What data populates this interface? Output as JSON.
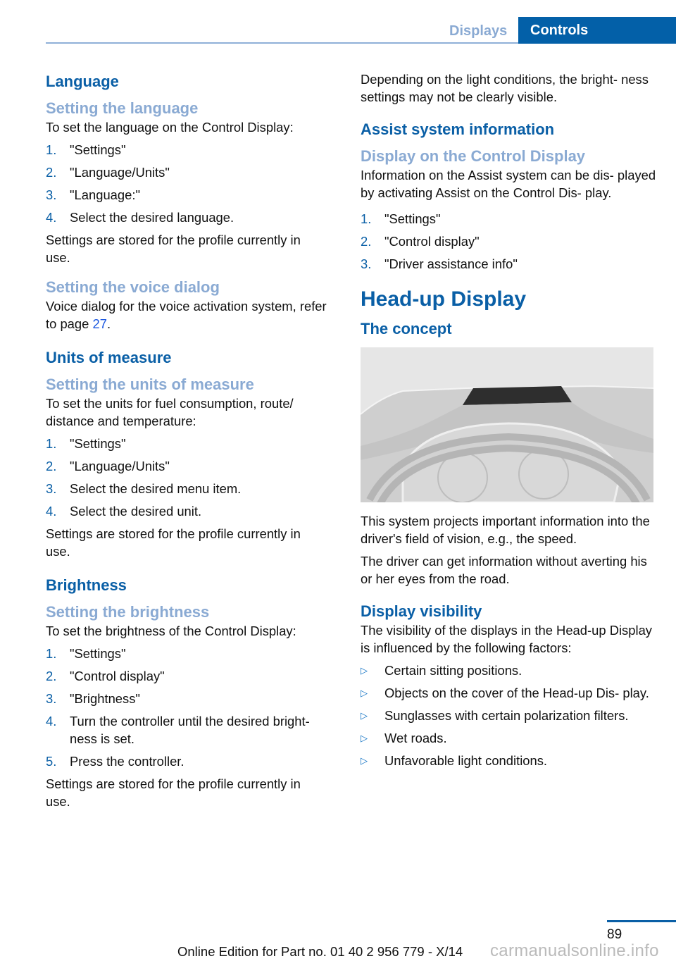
{
  "header": {
    "tabs": [
      {
        "label": "Displays",
        "active": false
      },
      {
        "label": "Controls",
        "active": true
      }
    ]
  },
  "left": {
    "language": {
      "title": "Language",
      "setting_title": "Setting the language",
      "intro": "To set the language on the Control Display:",
      "steps": [
        {
          "n": "1.",
          "text": "\"Settings\""
        },
        {
          "n": "2.",
          "text": "\"Language/Units\""
        },
        {
          "n": "3.",
          "text": "\"Language:\""
        },
        {
          "n": "4.",
          "text": "Select the desired language."
        }
      ],
      "note": "Settings are stored for the profile currently in use."
    },
    "voice": {
      "title": "Setting the voice dialog",
      "text_before": "Voice dialog for the voice activation system, refer to page ",
      "page_link": "27",
      "text_after": "."
    },
    "units": {
      "title": "Units of measure",
      "setting_title": "Setting the units of measure",
      "intro": "To set the units for fuel consumption, route/ distance and temperature:",
      "steps": [
        {
          "n": "1.",
          "text": "\"Settings\""
        },
        {
          "n": "2.",
          "text": "\"Language/Units\""
        },
        {
          "n": "3.",
          "text": "Select the desired menu item."
        },
        {
          "n": "4.",
          "text": "Select the desired unit."
        }
      ],
      "note": "Settings are stored for the profile currently in use."
    },
    "brightness": {
      "title": "Brightness",
      "setting_title": "Setting the brightness",
      "intro": "To set the brightness of the Control Display:",
      "steps": [
        {
          "n": "1.",
          "text": "\"Settings\""
        },
        {
          "n": "2.",
          "text": "\"Control display\""
        },
        {
          "n": "3.",
          "text": "\"Brightness\""
        },
        {
          "n": "4.",
          "text": "Turn the controller until the desired bright‑ ness is set."
        },
        {
          "n": "5.",
          "text": "Press the controller."
        }
      ],
      "note": "Settings are stored for the profile currently in use."
    }
  },
  "right": {
    "brightness_note": "Depending on the light conditions, the bright‑ ness settings may not be clearly visible.",
    "assist": {
      "title": "Assist system information",
      "setting_title": "Display on the Control Display",
      "intro": "Information on the Assist system can be dis‑ played by activating Assist on the Control Dis‑ play.",
      "steps": [
        {
          "n": "1.",
          "text": "\"Settings\""
        },
        {
          "n": "2.",
          "text": "\"Control display\""
        },
        {
          "n": "3.",
          "text": "\"Driver assistance info\""
        }
      ]
    },
    "hud": {
      "title": "Head-up Display",
      "concept_title": "The concept",
      "figure_alt": "Dashboard with Head-up Display projector behind steering wheel",
      "p1": "This system projects important information into the driver's field of vision, e.g., the speed.",
      "p2": "The driver can get information without averting his or her eyes from the road.",
      "visibility_title": "Display visibility",
      "visibility_intro": "The visibility of the displays in the Head-up Display is influenced by the following factors:",
      "factors": [
        "Certain sitting positions.",
        "Objects on the cover of the Head-up Dis‑ play.",
        "Sunglasses with certain polarization filters.",
        "Wet roads.",
        "Unfavorable light conditions."
      ]
    }
  },
  "footer": {
    "page_number": "89",
    "edition": "Online Edition for Part no. 01 40 2 956 779 - X/14",
    "watermark": "carmanualsonline.info"
  }
}
